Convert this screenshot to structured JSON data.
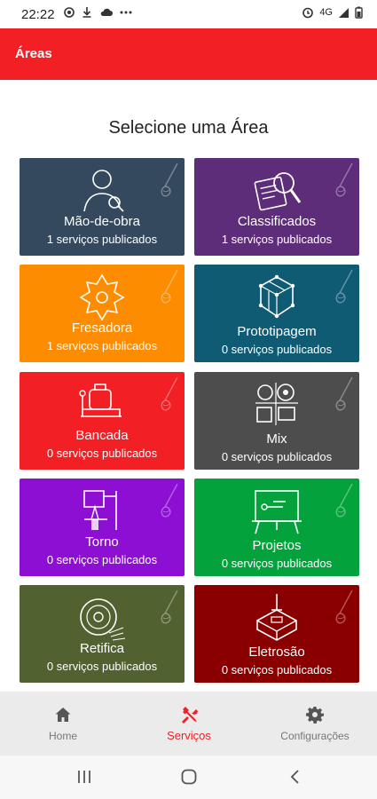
{
  "status": {
    "time": "22:22",
    "signal_text": "4G"
  },
  "app_bar": {
    "title": "Áreas"
  },
  "heading": "Selecione uma Área",
  "tiles": [
    {
      "name": "Mão-de-obra",
      "count": "1 serviços publicados",
      "color": "#34495e",
      "icon": "worker-icon"
    },
    {
      "name": "Classificados",
      "count": "1 serviços publicados",
      "color": "#5e2d79",
      "icon": "classifieds-icon"
    },
    {
      "name": "Fresadora",
      "count": "1 serviços publicados",
      "color": "#fd8c00",
      "icon": "milling-icon"
    },
    {
      "name": "Prototipagem",
      "count": "0 serviços publicados",
      "color": "#0f5b73",
      "icon": "prototype-icon"
    },
    {
      "name": "Bancada",
      "count": "0 serviços publicados",
      "color": "#f21f24",
      "icon": "bench-vise-icon"
    },
    {
      "name": "Mix",
      "count": "0 serviços publicados",
      "color": "#4d4d4d",
      "icon": "mix-icon"
    },
    {
      "name": "Torno",
      "count": "0 serviços publicados",
      "color": "#8e0fd4",
      "icon": "lathe-icon"
    },
    {
      "name": "Projetos",
      "count": "0 serviços publicados",
      "color": "#04a23d",
      "icon": "projects-icon"
    },
    {
      "name": "Retifica",
      "count": "0 serviços publicados",
      "color": "#516130",
      "icon": "grinding-icon"
    },
    {
      "name": "Eletrosão",
      "count": "0 serviços publicados",
      "color": "#8a0000",
      "icon": "edm-icon"
    }
  ],
  "bottom_nav": {
    "items": [
      {
        "label": "Home",
        "icon": "home-icon",
        "active": false
      },
      {
        "label": "Serviços",
        "icon": "tools-icon",
        "active": true
      },
      {
        "label": "Configurações",
        "icon": "gear-icon",
        "active": false
      }
    ]
  },
  "colors": {
    "accent": "#f21f24",
    "inactive": "#777777"
  }
}
